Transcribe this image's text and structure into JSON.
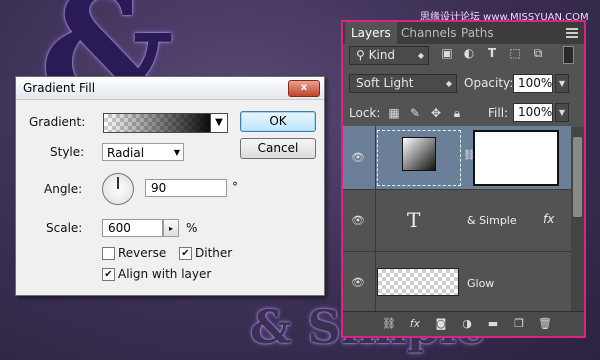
{
  "background": {
    "watermark": "思缘设计论坛 www.MISSYUAN.COM",
    "glyph_ampersand": "&",
    "glyph_text": "Simple"
  },
  "gradient_fill": {
    "title": "Gradient Fill",
    "close_symbol": "x",
    "gradient_label": "Gradient:",
    "style_label": "Style:",
    "style_value": "Radial",
    "angle_label": "Angle:",
    "angle_value": "90",
    "angle_unit": "°",
    "scale_label": "Scale:",
    "scale_value": "600",
    "scale_unit": "%",
    "reverse_label": "Reverse",
    "reverse_checked": false,
    "dither_label": "Dither",
    "dither_checked": true,
    "align_label": "Align with layer",
    "align_checked": true,
    "ok_label": "OK",
    "cancel_label": "Cancel"
  },
  "layers_panel": {
    "tabs": [
      "Layers",
      "Channels",
      "Paths"
    ],
    "filter_kind": "Kind",
    "filter_icons": [
      "image-icon",
      "adjustment-icon",
      "type-icon",
      "shape-icon",
      "smart-object-icon"
    ],
    "blend_mode": "Soft Light",
    "opacity_label": "Opacity:",
    "opacity_value": "100%",
    "lock_label": "Lock:",
    "fill_label": "Fill:",
    "fill_value": "100%",
    "layers": [
      {
        "name": "",
        "type": "gradient-fill",
        "selected": true
      },
      {
        "name": "& Simple",
        "type": "text",
        "fx": "fx"
      },
      {
        "name": "Glow",
        "type": "pixel"
      }
    ],
    "bottom_icons": [
      "link-icon",
      "fx-icon",
      "mask-icon",
      "adjustment-layer-icon",
      "folder-icon",
      "new-layer-icon",
      "trash-icon"
    ]
  },
  "colors": {
    "panel_highlight": "#e0217f",
    "selected_layer": "#6b7f99",
    "ok_button_border": "#3c7fb1"
  }
}
